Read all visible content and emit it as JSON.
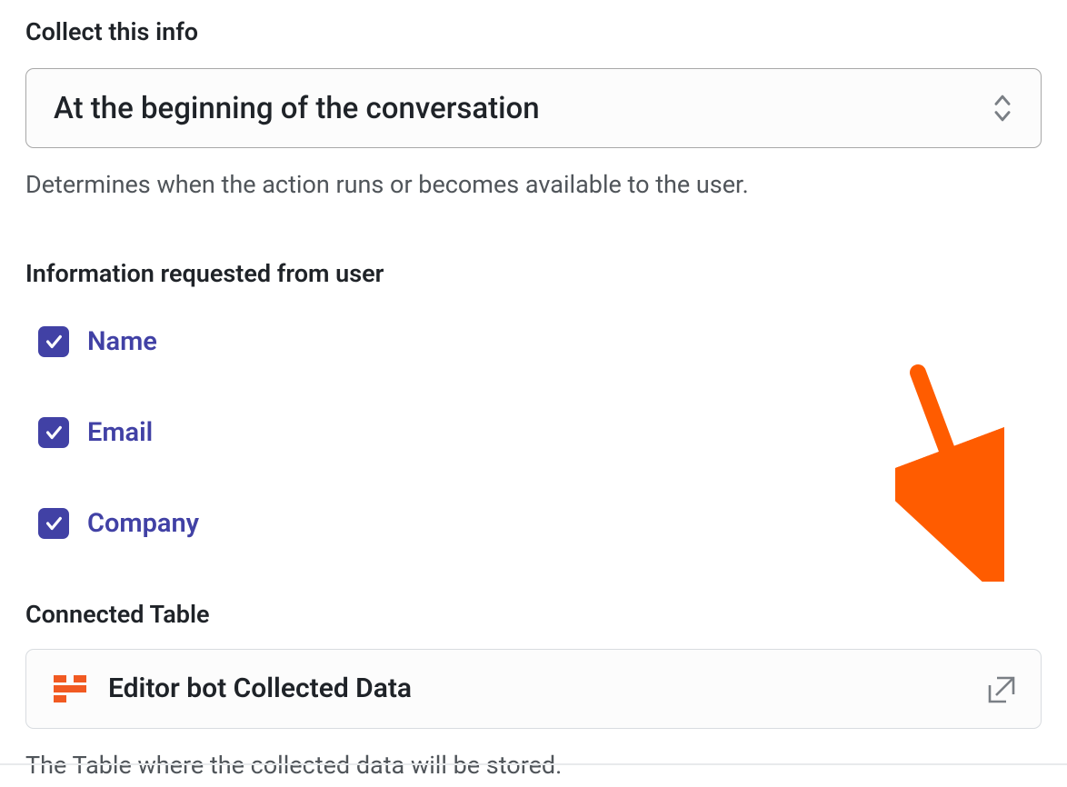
{
  "collect": {
    "label": "Collect this info",
    "select_value": "At the beginning of the conversation",
    "helper": "Determines when the action runs or becomes available to the user."
  },
  "info": {
    "label": "Information requested from user",
    "items": [
      {
        "label": "Name",
        "checked": true
      },
      {
        "label": "Email",
        "checked": true
      },
      {
        "label": "Company",
        "checked": true
      }
    ]
  },
  "connected": {
    "label": "Connected Table",
    "table_name": "Editor bot Collected Data",
    "helper": "The Table where the collected data will be stored."
  }
}
